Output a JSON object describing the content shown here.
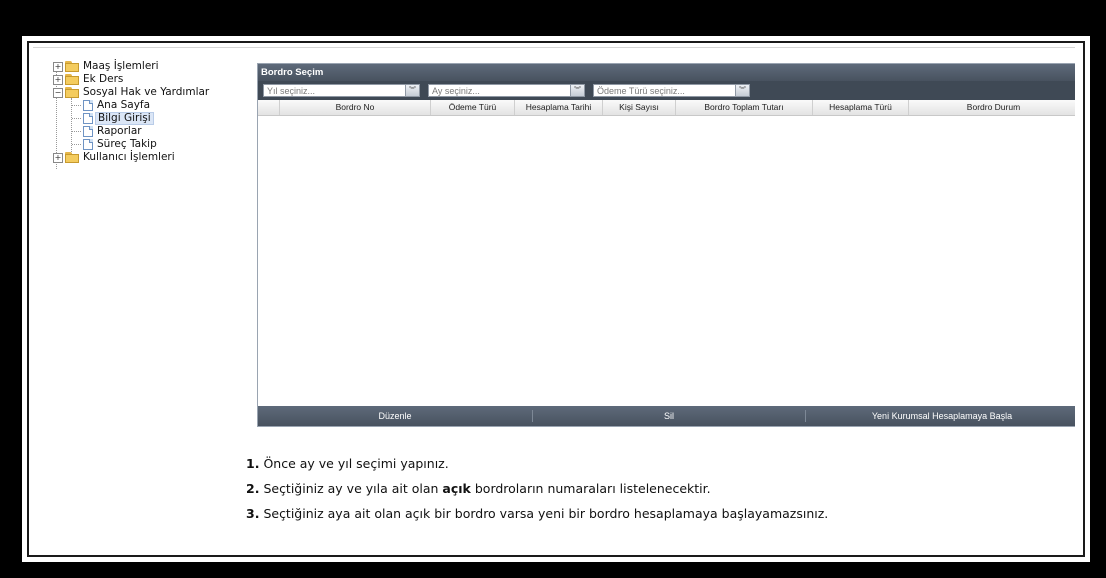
{
  "tree": {
    "items": [
      {
        "label": "Maaş İşlemleri"
      },
      {
        "label": "Ek Ders"
      },
      {
        "label": "Sosyal Hak ve Yardımlar"
      },
      {
        "label": "Ana Sayfa"
      },
      {
        "label": "Bilgi Girişi"
      },
      {
        "label": "Raporlar"
      },
      {
        "label": "Süreç Takip"
      },
      {
        "label": "Kullanıcı İşlemleri"
      }
    ]
  },
  "panel": {
    "title": "Bordro Seçim",
    "filters": {
      "year_placeholder": "Yıl seçiniz...",
      "month_placeholder": "Ay seçiniz...",
      "payment_type_placeholder": "Ödeme Türü seçiniz..."
    },
    "columns": [
      "Bordro No",
      "Ödeme Türü",
      "Hesaplama Tarihi",
      "Kişi Sayısı",
      "Bordro Toplam Tutarı",
      "Hesaplama Türü",
      "Bordro Durum"
    ],
    "actions": {
      "edit": "Düzenle",
      "delete": "Sil",
      "new": "Yeni Kurumsal Hesaplamaya Başla"
    }
  },
  "instructions": [
    {
      "num": "1.",
      "pre": "Önce ay ve yıl seçimi yapınız.",
      "bold": "",
      "post": ""
    },
    {
      "num": "2.",
      "pre": "Seçtiğiniz ay ve yıla ait olan",
      "bold": "açık",
      "post": "bordroların numaraları listelenecektir."
    },
    {
      "num": "3.",
      "pre": "Seçtiğiniz aya ait olan açık bir bordro varsa yeni bir bordro hesaplamaya başlayamazsınız.",
      "bold": "",
      "post": ""
    }
  ],
  "colors": {
    "header": "#48525f",
    "filter_bar": "#3f4955",
    "folder": "#f4cc5f"
  }
}
